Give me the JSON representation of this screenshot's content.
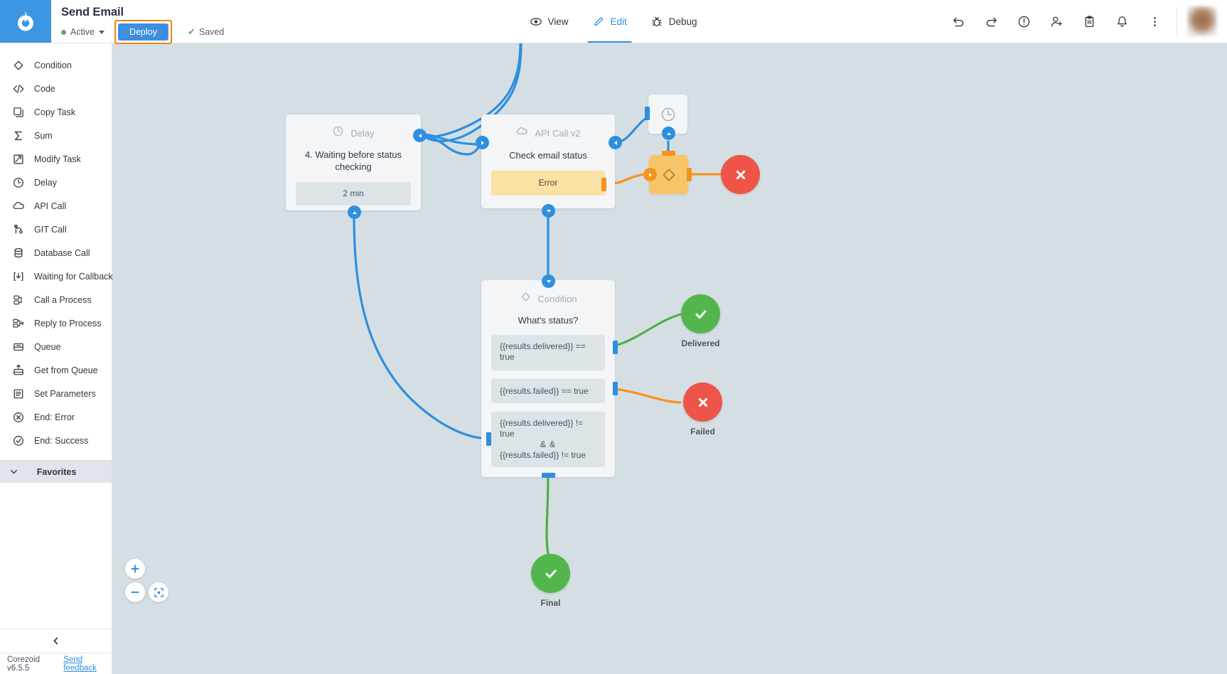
{
  "header": {
    "logo": "corezoid-logo",
    "process_title": "Send Email",
    "status_label": "Active",
    "status_color": "#52b64c",
    "deploy_label": "Deploy",
    "saved_label": "Saved",
    "saved_check": "✔",
    "highlight_color": "#f58410",
    "accent_color": "#3d8fe0",
    "nav": [
      {
        "label": "View",
        "icon": "eye-icon",
        "active": false
      },
      {
        "label": "Edit",
        "icon": "pencil-icon",
        "active": true
      },
      {
        "label": "Debug",
        "icon": "bug-icon",
        "active": false
      }
    ],
    "actions": [
      {
        "name": "undo-icon"
      },
      {
        "name": "redo-icon"
      },
      {
        "name": "info-icon"
      },
      {
        "name": "add-user-icon"
      },
      {
        "name": "clipboard-icon"
      },
      {
        "name": "bell-icon"
      },
      {
        "name": "more-vertical-icon"
      }
    ]
  },
  "sidebar": {
    "items": [
      {
        "label": "Condition",
        "icon": "diamond-icon"
      },
      {
        "label": "Code",
        "icon": "code-icon"
      },
      {
        "label": "Copy Task",
        "icon": "copy-icon"
      },
      {
        "label": "Sum",
        "icon": "sigma-icon"
      },
      {
        "label": "Modify Task",
        "icon": "modify-icon"
      },
      {
        "label": "Delay",
        "icon": "clock-icon"
      },
      {
        "label": "API Call",
        "icon": "cloud-icon"
      },
      {
        "label": "GIT Call",
        "icon": "git-icon"
      },
      {
        "label": "Database Call",
        "icon": "database-icon"
      },
      {
        "label": "Waiting for Callback",
        "icon": "callback-icon"
      },
      {
        "label": "Call a Process",
        "icon": "call-process-icon"
      },
      {
        "label": "Reply to Process",
        "icon": "reply-process-icon"
      },
      {
        "label": "Queue",
        "icon": "queue-icon"
      },
      {
        "label": "Get from Queue",
        "icon": "get-queue-icon"
      },
      {
        "label": "Set Parameters",
        "icon": "parameters-icon"
      },
      {
        "label": "End: Error",
        "icon": "end-error-icon"
      },
      {
        "label": "End: Success",
        "icon": "end-success-icon"
      }
    ],
    "favorites_label": "Favorites",
    "collapse_icon": "chevron-left-icon",
    "version": "Corezoid v6.5.5",
    "feedback_label": "Send feedback"
  },
  "canvas": {
    "background_color": "#d5dfe3",
    "nodes": {
      "delay": {
        "type": "Delay",
        "type_icon": "clock-icon",
        "title": "4. Waiting before status checking",
        "value_chip": "2 min"
      },
      "api_call": {
        "type": "API Call v2",
        "type_icon": "cloud-icon",
        "title": "Check email status",
        "error_chip": "Error"
      },
      "condition": {
        "type": "Condition",
        "type_icon": "diamond-icon",
        "title": "What's status?",
        "branches": [
          {
            "text": "{{results.delivered}} == true"
          },
          {
            "text": "{{results.failed}} == true"
          },
          {
            "text_line1": "{{results.delivered}}  != true",
            "operator": "& &",
            "text_line2": "{{results.failed}} !=  true"
          }
        ]
      },
      "escalation_clock": {
        "icon": "clock-icon"
      },
      "escalation_gateway": {
        "icon": "diamond-icon"
      }
    },
    "end_nodes": [
      {
        "label": "Delivered",
        "icon": "check-icon",
        "color": "#52b64c"
      },
      {
        "label": "Failed",
        "icon": "cross-icon",
        "color": "#ef5448"
      },
      {
        "label": "Final",
        "icon": "check-icon",
        "color": "#52b64c"
      },
      {
        "label": "",
        "icon": "cross-icon",
        "color": "#ef5448"
      }
    ],
    "zoom_controls": [
      {
        "name": "zoom-in-button",
        "glyph": "+"
      },
      {
        "name": "zoom-out-button",
        "glyph": "−"
      },
      {
        "name": "fit-to-screen-button",
        "glyph": "fit-icon"
      }
    ]
  }
}
